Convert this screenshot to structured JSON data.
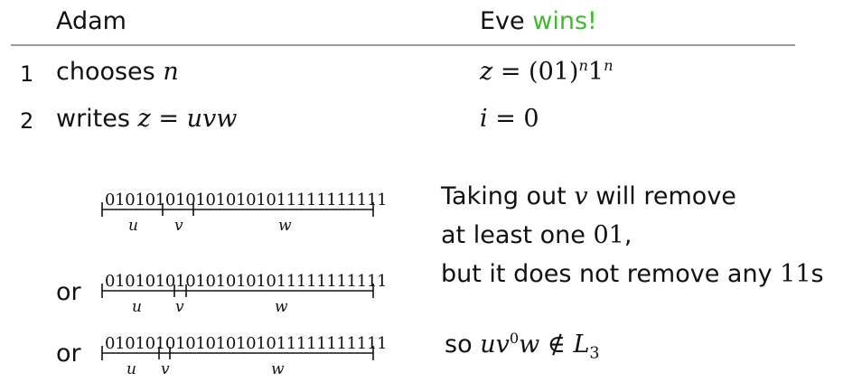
{
  "header": {
    "left": "Adam",
    "right_prefix": "Eve",
    "right_accent": "wins!"
  },
  "rows": [
    {
      "num": "1",
      "action": "chooses",
      "action_var": "n",
      "z": "z",
      "eq": " = ",
      "pair": "(01)",
      "exp1": "n",
      "one": "1",
      "exp2": "n"
    },
    {
      "num": "2",
      "action": "writes",
      "z_var": "z",
      "eq": " = ",
      "uvw": "uvw",
      "i": "i",
      "i_eq": " = 0"
    }
  ],
  "splits": [
    {
      "prefix": "",
      "bits": "0101010101010101011111111111",
      "u": "u",
      "v": "v",
      "w": "w"
    },
    {
      "prefix": "or",
      "bits": "0101010101010101011111111111",
      "u": "u",
      "v": "v",
      "w": "w"
    },
    {
      "prefix": "or",
      "bits": "0101010101010101011111111111",
      "u": "u",
      "v": "v",
      "w": "w"
    }
  ],
  "explanation": {
    "line1a": "Taking out",
    "line1var": "v",
    "line1b": "will remove",
    "line2a": "at least one",
    "line2num": "01",
    "line2b": ",",
    "line3a": "but it does not remove any",
    "line3num": "11",
    "line3b": "s",
    "concl_so": "so",
    "concl_u": "uv",
    "concl_exp": "0",
    "concl_w": "w",
    "concl_notin": "∉",
    "concl_L": "L",
    "concl_sub": "3"
  },
  "colors": {
    "accent": "#3dbb2f",
    "rule": "#9a9a9a"
  }
}
